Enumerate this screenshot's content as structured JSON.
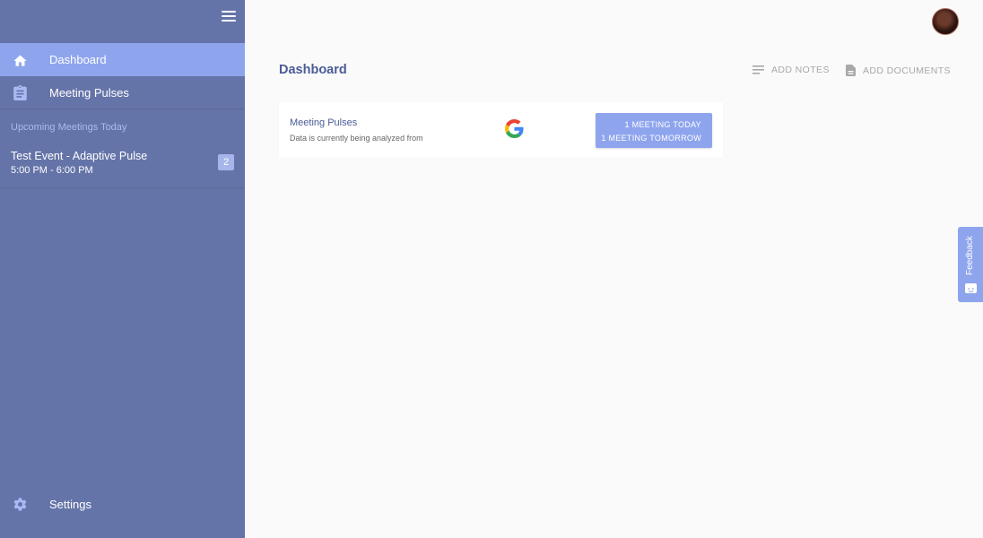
{
  "sidebar": {
    "nav": [
      {
        "label": "Dashboard",
        "icon": "home-icon",
        "active": true
      },
      {
        "label": "Meeting Pulses",
        "icon": "clipboard-icon",
        "active": false
      }
    ],
    "section_title": "Upcoming Meetings Today",
    "events": [
      {
        "title": "Test Event - Adaptive Pulse",
        "time": "5:00 PM - 6:00 PM",
        "badge": "2"
      }
    ],
    "settings_label": "Settings"
  },
  "header": {
    "page_title": "Dashboard",
    "add_notes": "ADD NOTES",
    "add_documents": "ADD DOCUMENTS"
  },
  "card": {
    "title": "Meeting Pulses",
    "subtitle": "Data is currently being analyzed from",
    "provider_icon": "google-icon",
    "button_line1": "1 MEETING TODAY",
    "button_line2": "1 MEETING TOMORROW"
  },
  "feedback": {
    "label": "Feedback"
  },
  "colors": {
    "sidebar": "#6574a8",
    "accent": "#8ea5ee",
    "title_text": "#4a5c96"
  }
}
